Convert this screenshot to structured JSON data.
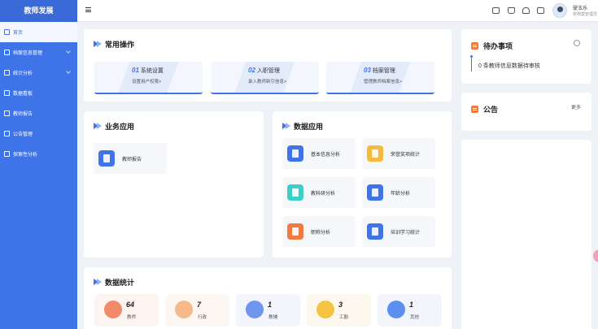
{
  "app": {
    "title": "教师发展"
  },
  "sidebar": {
    "items": [
      {
        "label": "首页",
        "icon": "home-icon",
        "active": true
      },
      {
        "label": "档案信息管理",
        "icon": "archive-icon",
        "expandable": true
      },
      {
        "label": "统计分析",
        "icon": "chart-icon",
        "expandable": true
      },
      {
        "label": "数据看板",
        "icon": "dashboard-icon"
      },
      {
        "label": "教师报告",
        "icon": "report-icon"
      },
      {
        "label": "公告管理",
        "icon": "megaphone-icon"
      },
      {
        "label": "探索性分析",
        "icon": "explore-icon"
      }
    ]
  },
  "user": {
    "name": "驶玉乐",
    "role": "校档案管理员"
  },
  "quick_ops": {
    "title": "常用操作",
    "items": [
      {
        "num": "01",
        "title": "系统设置",
        "sub": "设置用户权限>"
      },
      {
        "num": "02",
        "title": "入职管理",
        "sub": "录入教师新引信息>"
      },
      {
        "num": "03",
        "title": "档案管理",
        "sub": "管理教师档案信息>"
      }
    ]
  },
  "todo": {
    "title": "待办事项",
    "item": "0 条教师信息数据待审核"
  },
  "notice": {
    "title": "公告",
    "more": "更多"
  },
  "biz_apps": {
    "title": "业务应用",
    "items": [
      {
        "label": "教师报告",
        "color": "#3f74e8"
      }
    ]
  },
  "data_apps": {
    "title": "数据应用",
    "items": [
      {
        "label": "基本信息分析",
        "color": "#3f74e8"
      },
      {
        "label": "荣誉奖项统计",
        "color": "#f6b93b"
      },
      {
        "label": "教科研分析",
        "color": "#3ccfc7"
      },
      {
        "label": "年龄分析",
        "color": "#3f74e8"
      },
      {
        "label": "职称分析",
        "color": "#f07a3f"
      },
      {
        "label": "培训学习统计",
        "color": "#3f74e8"
      }
    ]
  },
  "stats": {
    "title": "数据统计",
    "items": [
      {
        "value": "64",
        "label": "教师",
        "color": "#f08a6a",
        "bg": "#fdf4f2"
      },
      {
        "value": "7",
        "label": "行政",
        "color": "#f5b98a",
        "bg": "#fdf7f1"
      },
      {
        "value": "1",
        "label": "教辅",
        "color": "#6f96ec",
        "bg": "#f2f5fc"
      },
      {
        "value": "3",
        "label": "工勤",
        "color": "#f6c443",
        "bg": "#fdf8ee"
      },
      {
        "value": "1",
        "label": "其他",
        "color": "#5d8ef0",
        "bg": "#f2f5fc"
      }
    ]
  }
}
